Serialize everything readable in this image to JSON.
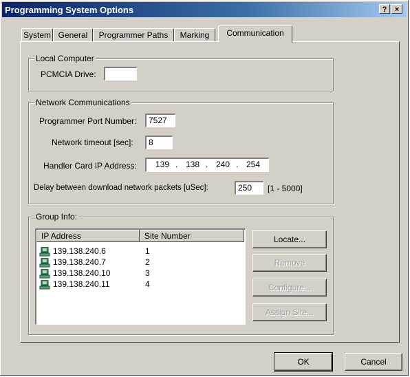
{
  "window": {
    "title": "Programming System Options",
    "help_label": "?",
    "close_label": "×"
  },
  "tabs": [
    {
      "label": "System",
      "active": false
    },
    {
      "label": "General",
      "active": false
    },
    {
      "label": "Programmer Paths",
      "active": false
    },
    {
      "label": "Marking",
      "active": false
    },
    {
      "label": "Communication",
      "active": true
    }
  ],
  "local_computer": {
    "legend": "Local Computer",
    "pcmcia_label": "PCMCIA Drive:",
    "pcmcia_value": ""
  },
  "network": {
    "legend": "Network Communications",
    "port_label": "Programmer Port Number:",
    "port_value": "7527",
    "timeout_label": "Network timeout [sec]:",
    "timeout_value": "8",
    "handler_ip_label": "Handler Card IP Address:",
    "handler_ip": [
      "139",
      "138",
      "240",
      "254"
    ],
    "ip_sep": ".",
    "delay_label": "Delay between download network packets [uSec]:",
    "delay_value": "250",
    "delay_range": "[1 - 5000]"
  },
  "group_info": {
    "legend": "Group Info:",
    "columns": [
      "IP Address",
      "Site Number"
    ],
    "rows": [
      {
        "ip": "139.138.240.6",
        "site": "1"
      },
      {
        "ip": "139.138.240.7",
        "site": "2"
      },
      {
        "ip": "139.138.240.10",
        "site": "3"
      },
      {
        "ip": "139.138.240.11",
        "site": "4"
      }
    ],
    "buttons": {
      "locate": "Locate...",
      "remove": "Remove",
      "configure": "Configure...",
      "assign_site": "Assign Site..."
    }
  },
  "footer": {
    "ok": "OK",
    "cancel": "Cancel"
  },
  "colors": {
    "face": "#d4d0c8",
    "title_start": "#0a246a",
    "title_end": "#a6caf0"
  },
  "icons": {
    "row_icon": "computer-icon"
  }
}
